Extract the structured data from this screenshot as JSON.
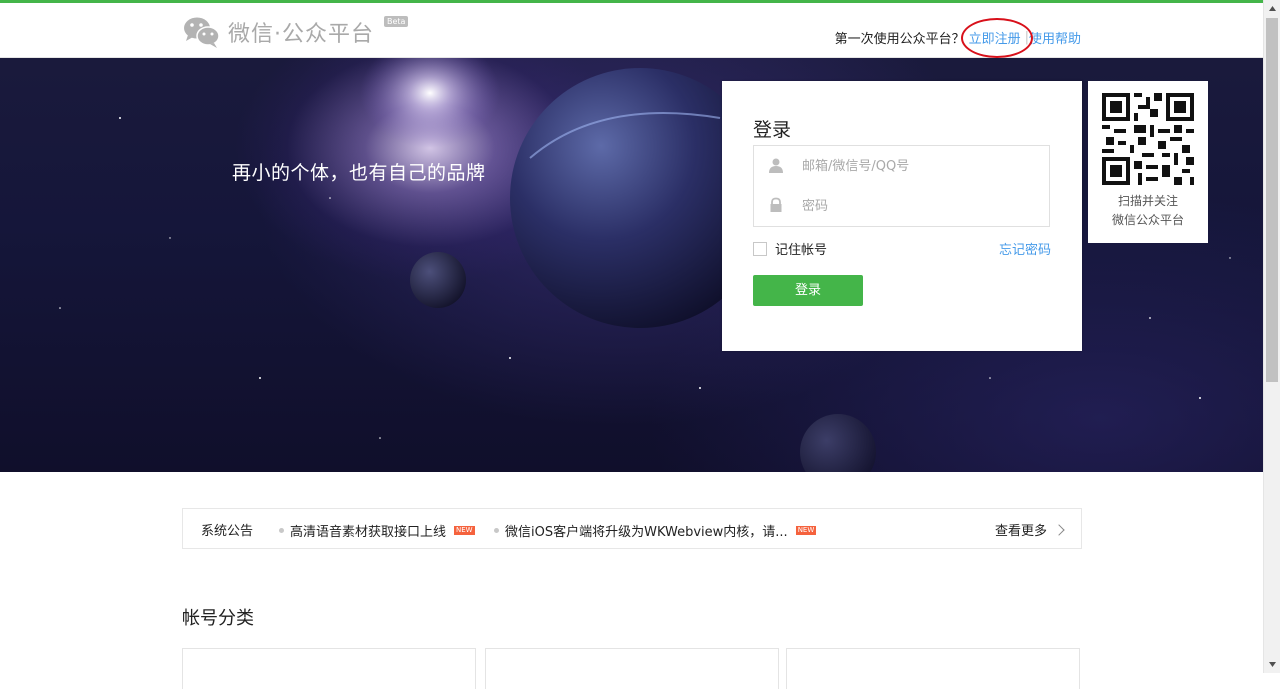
{
  "header": {
    "logo_text": "微信·公众平台",
    "beta_label": "Beta",
    "first_time_text": "第一次使用公众平台？",
    "register_link": "立即注册",
    "help_link": "使用帮助"
  },
  "banner": {
    "slogan": "再小的个体，也有自己的品牌"
  },
  "login": {
    "title": "登录",
    "account_placeholder": "邮箱/微信号/QQ号",
    "password_placeholder": "密码",
    "remember_label": "记住帐号",
    "forgot_link": "忘记密码",
    "submit_label": "登录"
  },
  "qr": {
    "line1": "扫描并关注",
    "line2": "微信公众平台"
  },
  "notice": {
    "label": "系统公告",
    "items": [
      {
        "text": "高清语音素材获取接口上线",
        "badge": "NEW"
      },
      {
        "text": "微信iOS客户端将升级为WKWebview内核，请...",
        "badge": "NEW"
      }
    ],
    "more": "查看更多"
  },
  "categories": {
    "title": "帐号分类"
  },
  "colors": {
    "brand_green": "#44b549",
    "link_blue": "#459ae9",
    "annotation_red": "#d8101a"
  }
}
